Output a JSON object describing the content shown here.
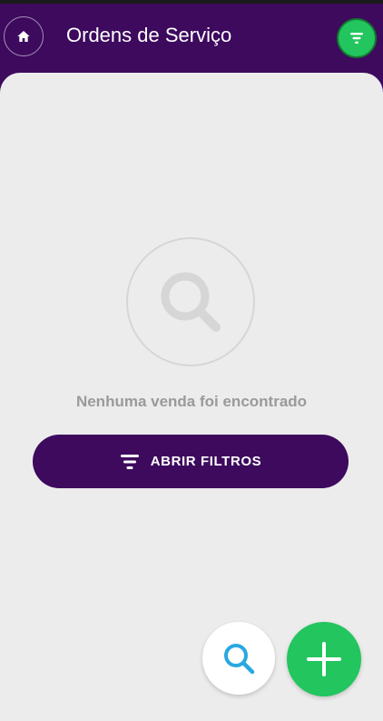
{
  "header": {
    "title": "Ordens de Serviço",
    "home_icon": "home-icon",
    "filter_icon": "filter-icon"
  },
  "empty_state": {
    "icon": "search-icon",
    "message": "Nenhuma venda foi encontrado"
  },
  "actions": {
    "open_filters_label": "ABRIR FILTROS",
    "search_fab_icon": "search-icon",
    "add_fab_icon": "plus-icon"
  },
  "colors": {
    "primary": "#3d0a5e",
    "accent": "#22c55e",
    "background": "#ececec",
    "muted_text": "#9a9a9a",
    "search_icon": "#29a8e0"
  }
}
